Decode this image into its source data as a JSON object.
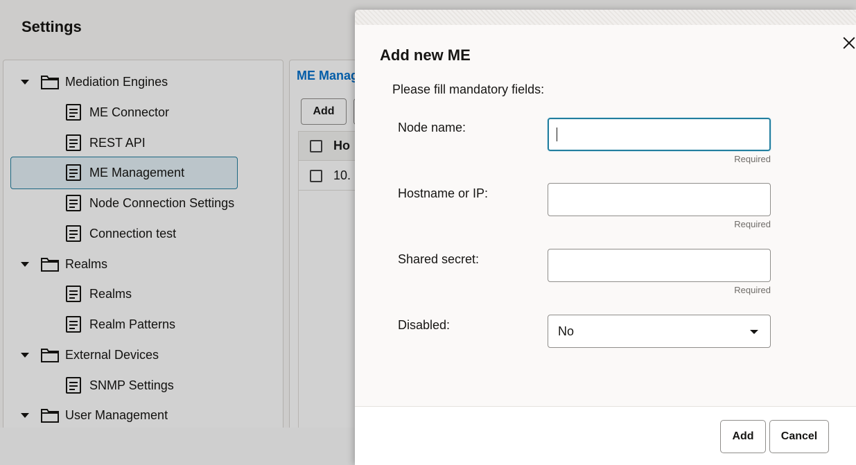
{
  "page": {
    "title": "Settings"
  },
  "tree": {
    "items": [
      {
        "label": "Mediation Engines",
        "kind": "folder"
      },
      {
        "label": "ME Connector",
        "kind": "doc"
      },
      {
        "label": "REST API",
        "kind": "doc"
      },
      {
        "label": "ME Management",
        "kind": "doc",
        "selected": true
      },
      {
        "label": "Node Connection Settings",
        "kind": "doc"
      },
      {
        "label": "Connection test",
        "kind": "doc"
      },
      {
        "label": "Realms",
        "kind": "folder"
      },
      {
        "label": "Realms",
        "kind": "doc"
      },
      {
        "label": "Realm Patterns",
        "kind": "doc"
      },
      {
        "label": "External Devices",
        "kind": "folder"
      },
      {
        "label": "SNMP Settings",
        "kind": "doc"
      },
      {
        "label": "User Management",
        "kind": "folder"
      }
    ]
  },
  "main": {
    "breadcrumb": "ME Manag",
    "add_label": "Add",
    "table": {
      "header": "Ho",
      "row_value": "10."
    }
  },
  "dialog": {
    "title": "Add new ME",
    "instructions": "Please fill mandatory fields:",
    "fields": {
      "node_name": {
        "label": "Node name:",
        "value": "",
        "hint": "Required"
      },
      "hostname": {
        "label": "Hostname or IP:",
        "value": "",
        "hint": "Required"
      },
      "shared_secret": {
        "label": "Shared secret:",
        "value": "",
        "hint": "Required"
      },
      "disabled": {
        "label": "Disabled:",
        "selected": "No"
      }
    },
    "footer": {
      "add_label": "Add",
      "cancel_label": "Cancel"
    }
  },
  "colors": {
    "accent": "#227e9e",
    "link": "#0572ce"
  }
}
